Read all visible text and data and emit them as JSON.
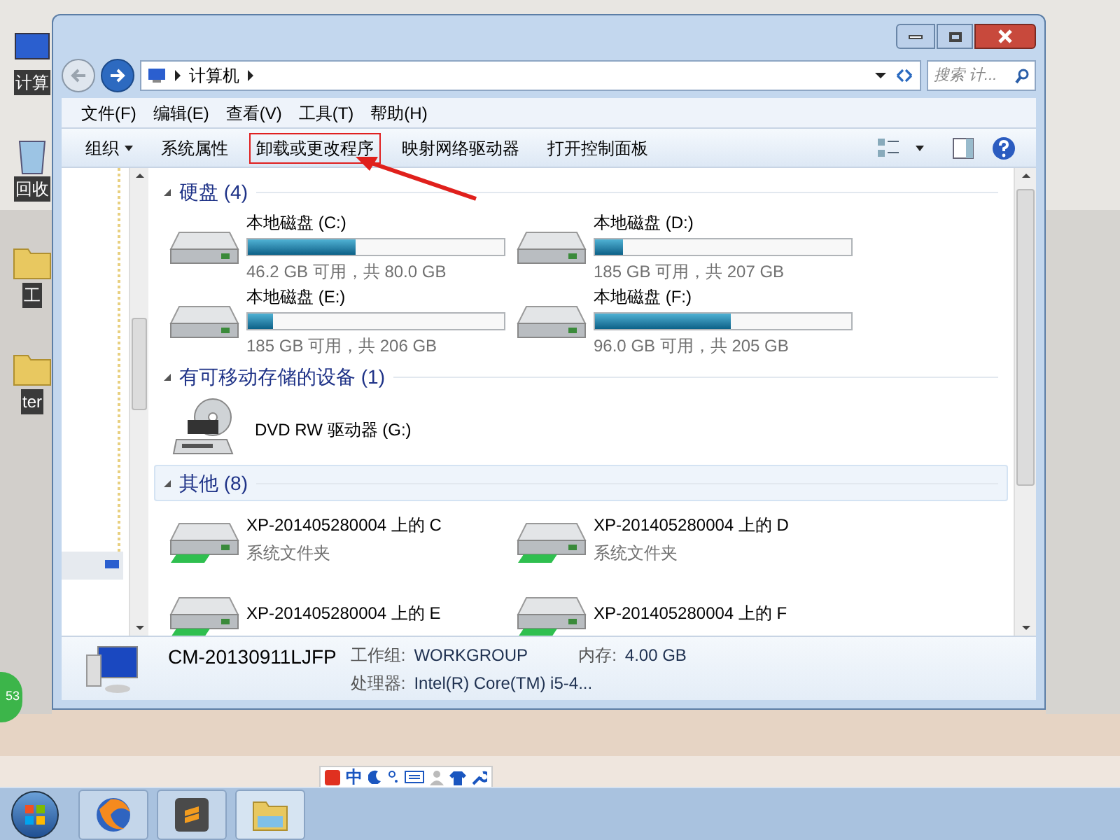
{
  "desktop": {
    "icons": [
      {
        "label": "计算",
        "kind": "computer"
      },
      {
        "label": "回收",
        "kind": "bin"
      },
      {
        "label": "工",
        "kind": "folder"
      },
      {
        "label": "ter",
        "kind": "folder"
      }
    ],
    "badge": "53"
  },
  "window": {
    "address": [
      "计算机"
    ],
    "search": {
      "placeholder": "搜索 计..."
    },
    "menu": [
      "文件(F)",
      "编辑(E)",
      "查看(V)",
      "工具(T)",
      "帮助(H)"
    ],
    "commands": [
      {
        "label": "组织",
        "dropdown": true,
        "highlighted": false
      },
      {
        "label": "系统属性",
        "dropdown": false,
        "highlighted": false
      },
      {
        "label": "卸载或更改程序",
        "dropdown": false,
        "highlighted": true
      },
      {
        "label": "映射网络驱动器",
        "dropdown": false,
        "highlighted": false
      },
      {
        "label": "打开控制面板",
        "dropdown": false,
        "highlighted": false
      }
    ],
    "groups": [
      {
        "title": "硬盘 (4)",
        "selected": false,
        "items": [
          {
            "kind": "drive",
            "name": "本地磁盘 (C:)",
            "level": 0.42,
            "info": "46.2 GB 可用，共 80.0 GB"
          },
          {
            "kind": "drive",
            "name": "本地磁盘 (D:)",
            "level": 0.11,
            "info": "185 GB 可用，共 207 GB"
          },
          {
            "kind": "drive",
            "name": "本地磁盘 (E:)",
            "level": 0.1,
            "info": "185 GB 可用，共 206 GB"
          },
          {
            "kind": "drive",
            "name": "本地磁盘 (F:)",
            "level": 0.53,
            "info": "96.0 GB 可用，共 205 GB"
          }
        ]
      },
      {
        "title": "有可移动存储的设备 (1)",
        "selected": false,
        "items": [
          {
            "kind": "dvd",
            "name": "DVD RW 驱动器 (G:)"
          }
        ]
      },
      {
        "title": "其他 (8)",
        "selected": true,
        "items": [
          {
            "kind": "network",
            "name": "XP-201405280004 上的 C",
            "info": "系统文件夹"
          },
          {
            "kind": "network",
            "name": "XP-201405280004 上的 D",
            "info": "系统文件夹"
          },
          {
            "kind": "network",
            "name": "XP-201405280004 上的 E"
          },
          {
            "kind": "network",
            "name": "XP-201405280004 上的 F"
          }
        ]
      }
    ],
    "details": {
      "name": "CM-20130911LJFP",
      "fields": [
        {
          "label": "工作组:",
          "value": "WORKGROUP"
        },
        {
          "label": "内存:",
          "value": "4.00 GB"
        },
        {
          "label": "处理器:",
          "value": "Intel(R) Core(TM) i5-4..."
        }
      ]
    }
  },
  "ime": {
    "mode": "中"
  }
}
